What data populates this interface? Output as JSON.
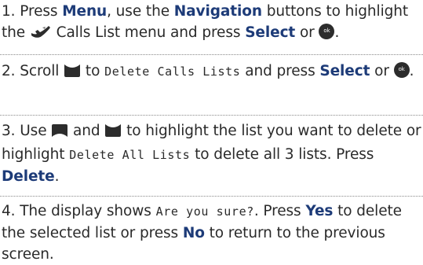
{
  "steps": [
    {
      "number": "1.",
      "t1": " Press ",
      "b1": "Menu",
      "t2": ", use the ",
      "b2": "Navigation",
      "t3": " buttons to highlight the ",
      "t4": " Calls List menu and press ",
      "b3": "Select",
      "t5": " or ",
      "t6": "."
    },
    {
      "number": "2.",
      "t1": " Scroll ",
      "t2": " to ",
      "m1": "Delete Calls Lists",
      "t3": " and press ",
      "b1": "Select",
      "t4": " or ",
      "t5": "."
    },
    {
      "number": "3.",
      "t1": " Use ",
      "t2": " and ",
      "t3": " to highlight the list you want to delete or highlight ",
      "m1": "Delete All Lists",
      "t4": " to delete all 3 lists. Press ",
      "b1": "Delete",
      "t5": "."
    },
    {
      "number": "4.",
      "t1": " The display shows ",
      "m1": "Are you sure?",
      "t2": ". Press ",
      "b1": "Yes",
      "t3": " to delete the selected list or press ",
      "b2": "No",
      "t4": " to return to the previous screen."
    }
  ],
  "colors": {
    "text": "#2a2a2a",
    "key_highlight": "#1d3b78",
    "icon": "#2c2c2c",
    "divider": "#8a8a8a"
  },
  "icons": [
    "calls-list-icon",
    "ok-button-icon",
    "nav-down-icon",
    "nav-up-icon"
  ]
}
